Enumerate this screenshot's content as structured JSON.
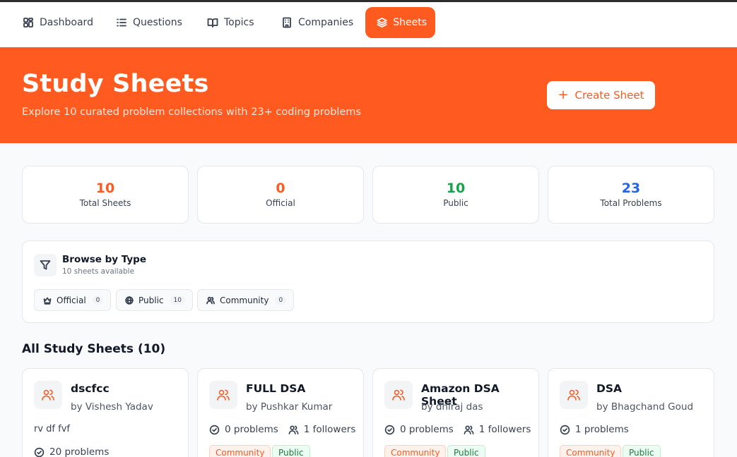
{
  "nav": [
    {
      "label": "Dashboard",
      "icon": "dashboard-icon"
    },
    {
      "label": "Questions",
      "icon": "list-icon"
    },
    {
      "label": "Topics",
      "icon": "book-icon"
    },
    {
      "label": "Companies",
      "icon": "building-icon"
    },
    {
      "label": "Sheets",
      "icon": "layers-icon",
      "active": true
    }
  ],
  "hero": {
    "title": "Study Sheets",
    "subtitle": "Explore 10 curated problem collections with 23+ coding problems",
    "create_label": "Create Sheet"
  },
  "stats": [
    {
      "value": "10",
      "label": "Total Sheets",
      "color": "#ff5a1f"
    },
    {
      "value": "0",
      "label": "Official",
      "color": "#ff5a1f"
    },
    {
      "value": "10",
      "label": "Public",
      "color": "#16a34a"
    },
    {
      "value": "23",
      "label": "Total Problems",
      "color": "#2563eb"
    }
  ],
  "browse": {
    "title": "Browse by Type",
    "subtitle": "10 sheets available",
    "chips": [
      {
        "label": "Official",
        "count": "0",
        "icon": "crown-icon"
      },
      {
        "label": "Public",
        "count": "10",
        "icon": "globe-icon"
      },
      {
        "label": "Community",
        "count": "0",
        "icon": "users-icon"
      }
    ]
  },
  "section_title": "All Study Sheets (10)",
  "sheets": [
    {
      "title": "dscfcc",
      "author": "by Vishesh Yadav",
      "description": "rv df fvf",
      "problems": "20 problems",
      "followers": "",
      "tags": []
    },
    {
      "title": "FULL DSA",
      "author": "by Pushkar Kumar",
      "description": "",
      "problems": "0 problems",
      "followers": "1 followers",
      "tags": [
        "Community",
        "Public"
      ]
    },
    {
      "title": "Amazon DSA Sheet",
      "author": "by dhiraj das",
      "description": "",
      "problems": "0 problems",
      "followers": "1 followers",
      "tags": [
        "Community",
        "Public"
      ]
    },
    {
      "title": "DSA",
      "author": "by Bhagchand Goud",
      "description": "",
      "problems": "1 problems",
      "followers": "",
      "tags": [
        "Community",
        "Public"
      ]
    }
  ],
  "colors": {
    "accent": "#ff5a1f",
    "green": "#16a34a",
    "blue": "#2563eb"
  }
}
